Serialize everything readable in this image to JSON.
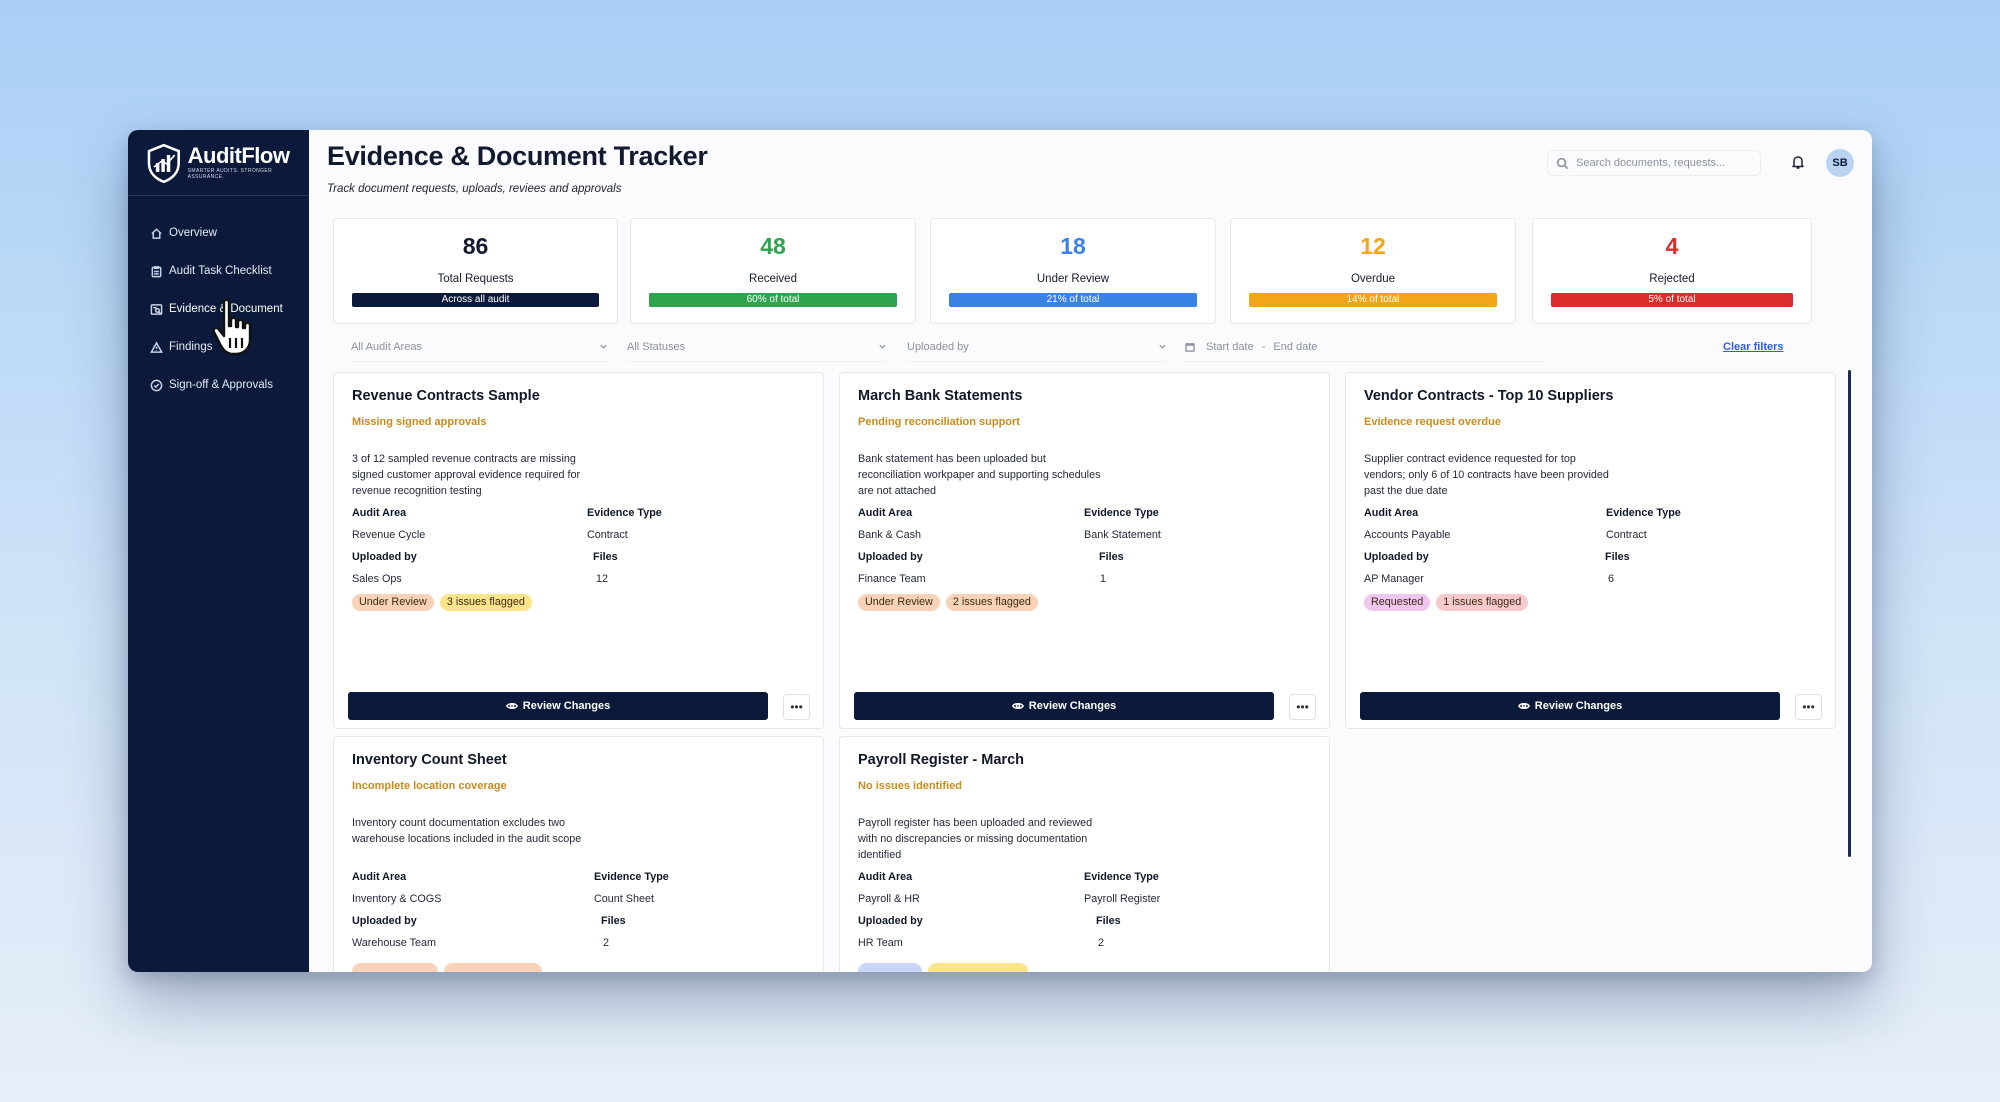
{
  "app": {
    "brand": "AuditFlow",
    "tagline": "SMARTER AUDITS. STRONGER ASSURANCE."
  },
  "sidebar": {
    "items": [
      {
        "label": "Overview",
        "icon": "home-icon"
      },
      {
        "label": "Audit Task Checklist",
        "icon": "clipboard-icon"
      },
      {
        "label": "Evidence & Document",
        "icon": "document-search-icon",
        "active": true
      },
      {
        "label": "Findings",
        "icon": "warning-icon"
      },
      {
        "label": "Sign-off & Approvals",
        "icon": "check-circle-icon"
      }
    ]
  },
  "header": {
    "title": "Evidence & Document Tracker",
    "subtitle": "Track document requests, uploads, reviees and approvals",
    "search_placeholder": "Search documents, requests...",
    "user_initials": "SB"
  },
  "stats": [
    {
      "value": "86",
      "label": "Total Requests",
      "bar": "Across all audit",
      "color": "#0b1a3a",
      "value_color": "#111a2e"
    },
    {
      "value": "48",
      "label": "Received",
      "bar": "60% of total",
      "color": "#2ea44f",
      "value_color": "#2ea44f"
    },
    {
      "value": "18",
      "label": "Under Review",
      "bar": "21% of total",
      "color": "#3b82e6",
      "value_color": "#3b82e6"
    },
    {
      "value": "12",
      "label": "Overdue",
      "bar": "14% of total",
      "color": "#f2a516",
      "value_color": "#f2a516"
    },
    {
      "value": "4",
      "label": "Rejected",
      "bar": "5% of total",
      "color": "#dc2b2b",
      "value_color": "#dc2b2b"
    }
  ],
  "filters": {
    "audit_area": "All Audit Areas",
    "status": "All Statuses",
    "uploaded_by": "Uploaded by",
    "start_date": "Start date",
    "date_sep": "-",
    "end_date": "End date",
    "clear": "Clear filters"
  },
  "labels": {
    "audit_area": "Audit Area",
    "evidence_type": "Evidence Type",
    "uploaded_by": "Uploaded by",
    "files": "Files",
    "review_button": "Review Changes",
    "more": "•••"
  },
  "cards": [
    {
      "title": "Revenue Contracts Sample",
      "issue": "Missing signed approvals",
      "description": "3 of 12 sampled revenue contracts are missing signed customer approval evidence required for revenue recognition testing",
      "audit_area": "Revenue Cycle",
      "evidence_type": "Contract",
      "uploaded_by": "Sales Ops",
      "files": "12",
      "status": "Under Review",
      "status_color": "#f9d2b8",
      "flag": "3 issues flagged",
      "flag_color": "#fbe58a"
    },
    {
      "title": "March Bank Statements",
      "issue": "Pending reconciliation support",
      "description": "Bank statement has been uploaded but reconciliation workpaper and supporting schedules are not attached",
      "audit_area": "Bank & Cash",
      "evidence_type": "Bank Statement",
      "uploaded_by": "Finance Team",
      "files": "1",
      "status": "Under Review",
      "status_color": "#f9d2b8",
      "flag": "2 issues flagged",
      "flag_color": "#f9d2b8"
    },
    {
      "title": "Vendor Contracts - Top 10 Suppliers",
      "issue": "Evidence request overdue",
      "description": "Supplier contract evidence requested for top vendors; only 6 of 10 contracts have been provided past the due date",
      "audit_area": "Accounts Payable",
      "evidence_type": "Contract",
      "uploaded_by": "AP Manager",
      "files": "6",
      "status": "Requested",
      "status_color": "#efc6f0",
      "flag": "1 issues flagged",
      "flag_color": "#f8c9cc"
    },
    {
      "title": "Inventory Count Sheet",
      "issue": "Incomplete location coverage",
      "description": "Inventory count documentation excludes two warehouse locations included in the audit scope",
      "audit_area": "Inventory & COGS",
      "evidence_type": "Count Sheet",
      "uploaded_by": "Warehouse Team",
      "files": "2",
      "status": "",
      "status_color": "#f9d2b8",
      "flag": "",
      "flag_color": "#f9d2b8"
    },
    {
      "title": "Payroll Register - March",
      "issue": "No issues identified",
      "description": "Payroll register has been uploaded and reviewed with no discrepancies or missing documentation identified",
      "audit_area": "Payroll & HR",
      "evidence_type": "Payroll Register",
      "uploaded_by": "HR Team",
      "files": "2",
      "status": "",
      "status_color": "#c9d6f6",
      "flag": "",
      "flag_color": "#fbe58a"
    }
  ]
}
